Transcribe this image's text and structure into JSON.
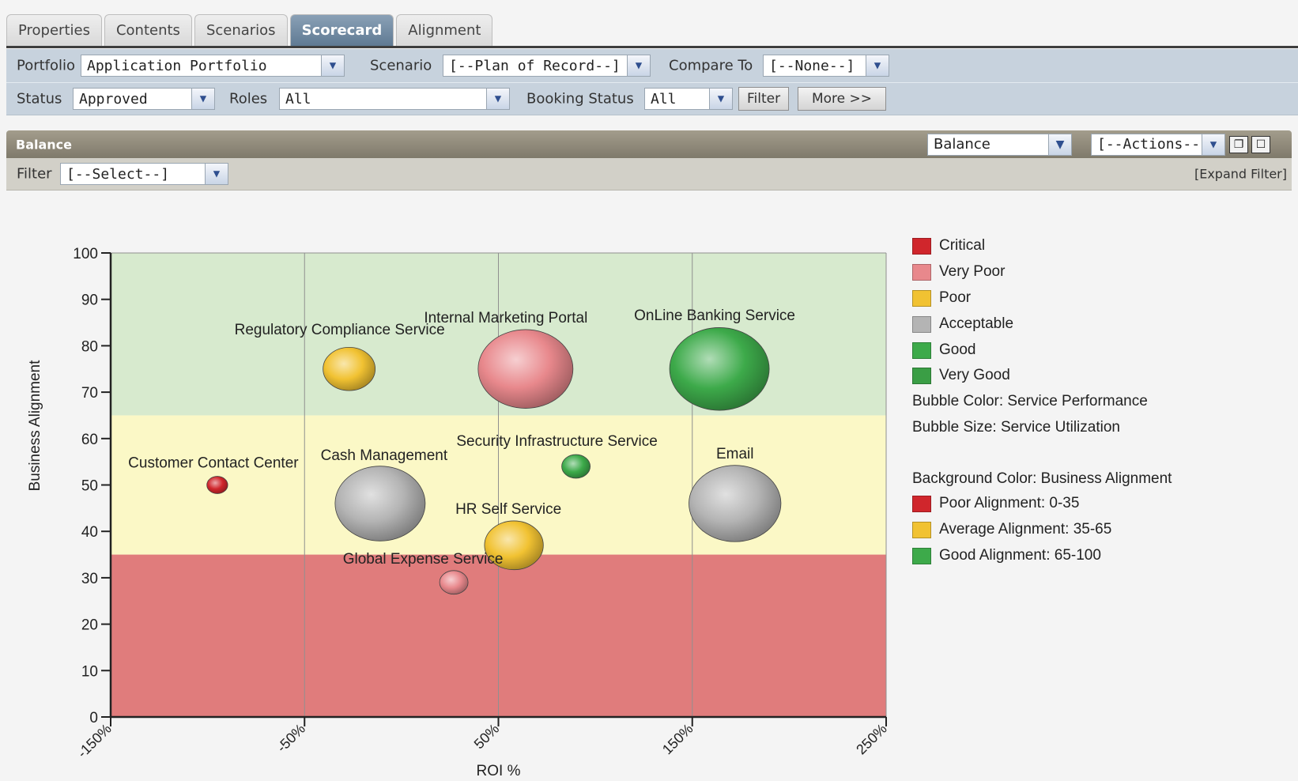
{
  "tabs": [
    {
      "label": "Properties",
      "active": false
    },
    {
      "label": "Contents",
      "active": false
    },
    {
      "label": "Scenarios",
      "active": false
    },
    {
      "label": "Scorecard",
      "active": true
    },
    {
      "label": "Alignment",
      "active": false
    }
  ],
  "filters": {
    "portfolio_label": "Portfolio",
    "portfolio_value": "Application Portfolio",
    "scenario_label": "Scenario",
    "scenario_value": "[--Plan of Record--]",
    "compare_label": "Compare To",
    "compare_value": "[--None--]",
    "status_label": "Status",
    "status_value": "Approved",
    "roles_label": "Roles",
    "roles_value": "All",
    "booking_label": "Booking Status",
    "booking_value": "All",
    "filter_button": "Filter",
    "more_button": "More >>"
  },
  "panel": {
    "title": "Balance",
    "view_select": "Balance",
    "actions_select": "[--Actions--]",
    "filter_label": "Filter",
    "filter_select": "[--Select--]",
    "expand_filter": "[Expand Filter]"
  },
  "legend": {
    "performance": [
      {
        "label": "Critical",
        "color": "#d0262c"
      },
      {
        "label": "Very Poor",
        "color": "#e8888c"
      },
      {
        "label": "Poor",
        "color": "#f1c232"
      },
      {
        "label": "Acceptable",
        "color": "#b4b4b4"
      },
      {
        "label": "Good",
        "color": "#3daa4a"
      },
      {
        "label": "Very Good",
        "color": "#3a9e45"
      }
    ],
    "bubble_color_text": "Bubble Color: Service Performance",
    "bubble_size_text": "Bubble Size: Service Utilization",
    "background_text": "Background Color: Business Alignment",
    "alignment": [
      {
        "label": "Poor Alignment: 0-35",
        "color": "#d0262c"
      },
      {
        "label": "Average Alignment: 35-65",
        "color": "#f1c232"
      },
      {
        "label": "Good Alignment: 65-100",
        "color": "#3daa4a"
      }
    ]
  },
  "chart_data": {
    "type": "scatter",
    "subtype": "bubble",
    "xlabel": "ROI %",
    "ylabel": "Business Alignment",
    "xlim": [
      -150,
      250
    ],
    "ylim": [
      0,
      100
    ],
    "x_ticks": [
      -150,
      -50,
      50,
      150,
      250
    ],
    "x_tick_labels": [
      "-150%",
      "-50%",
      "50%",
      "150%",
      "250%"
    ],
    "y_ticks": [
      0,
      10,
      20,
      30,
      40,
      50,
      60,
      70,
      80,
      90,
      100
    ],
    "y_tick_labels": [
      "0",
      "10",
      "20",
      "30",
      "40",
      "50",
      "60",
      "70",
      "80",
      "90",
      "100"
    ],
    "grid": true,
    "background_bands": [
      {
        "from": 0,
        "to": 35,
        "color": "#e07c7c",
        "label": "Poor Alignment: 0-35"
      },
      {
        "from": 35,
        "to": 65,
        "color": "#fbf8c6",
        "label": "Average Alignment: 35-65"
      },
      {
        "from": 65,
        "to": 100,
        "color": "#d7eace",
        "label": "Good Alignment: 65-100"
      }
    ],
    "points": [
      {
        "name": "Regulatory Compliance Service",
        "x": -27,
        "y": 75,
        "size": 0.55,
        "performance": "Poor"
      },
      {
        "name": "Internal Marketing Portal",
        "x": 64,
        "y": 75,
        "size": 1.0,
        "performance": "Very Poor"
      },
      {
        "name": "OnLine Banking Service",
        "x": 164,
        "y": 75,
        "size": 1.05,
        "performance": "Good"
      },
      {
        "name": "Customer Contact Center",
        "x": -95,
        "y": 50,
        "size": 0.22,
        "performance": "Critical"
      },
      {
        "name": "Cash Management",
        "x": -11,
        "y": 46,
        "size": 0.95,
        "performance": "Acceptable"
      },
      {
        "name": "Security Infrastructure Service",
        "x": 90,
        "y": 54,
        "size": 0.3,
        "performance": "Good"
      },
      {
        "name": "Email",
        "x": 172,
        "y": 46,
        "size": 0.97,
        "performance": "Acceptable"
      },
      {
        "name": "HR Self Service",
        "x": 58,
        "y": 37,
        "size": 0.62,
        "performance": "Poor"
      },
      {
        "name": "Global Expense Service",
        "x": 27,
        "y": 29,
        "size": 0.3,
        "performance": "Very Poor"
      }
    ]
  }
}
